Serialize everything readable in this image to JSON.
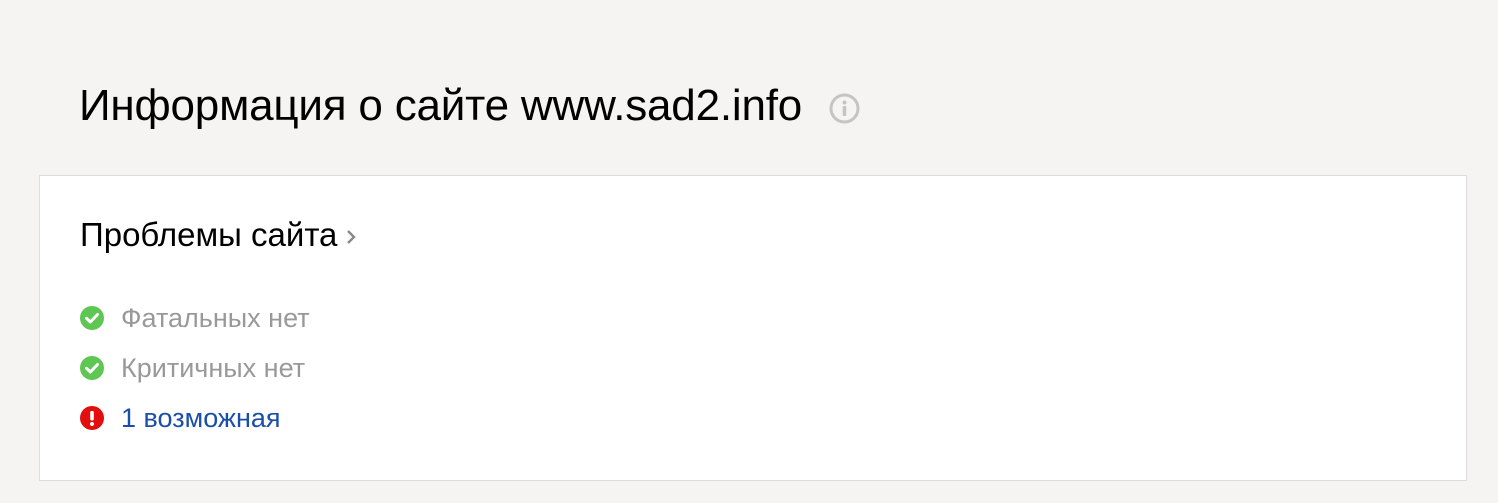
{
  "header": {
    "title": "Информация о сайте www.sad2.info",
    "info_icon": "info-circle-icon"
  },
  "problems_card": {
    "title": "Проблемы сайта",
    "chevron_icon": "chevron-right-icon",
    "items": [
      {
        "text": "Фатальных нет",
        "status": "ok",
        "icon": "check-circle-icon",
        "color": "#5ec653",
        "link": false
      },
      {
        "text": "Критичных нет",
        "status": "ok",
        "icon": "check-circle-icon",
        "color": "#5ec653",
        "link": false
      },
      {
        "text": "1 возможная",
        "status": "warning",
        "icon": "exclamation-circle-icon",
        "color": "#e30e0e",
        "link": true
      }
    ]
  },
  "colors": {
    "background": "#f5f4f2",
    "card": "#ffffff",
    "muted_text": "#999999",
    "link": "#1a4ea8",
    "ok": "#5ec653",
    "error": "#e30e0e",
    "info_icon": "#c4c4c4"
  }
}
